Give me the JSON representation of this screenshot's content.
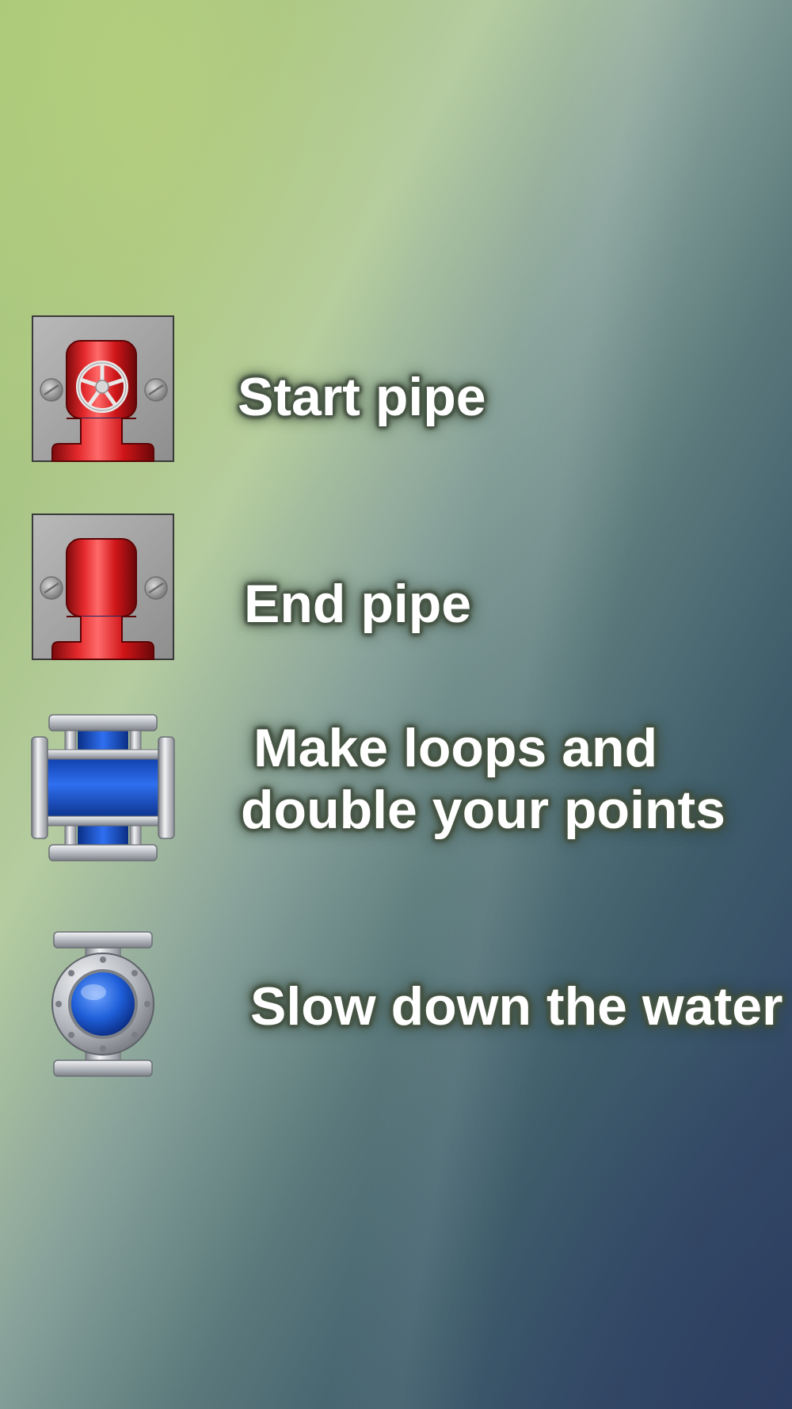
{
  "help": {
    "items": [
      {
        "icon": "start-pipe-icon",
        "label": "Start pipe"
      },
      {
        "icon": "end-pipe-icon",
        "label": "End pipe"
      },
      {
        "icon": "cross-pipe-icon",
        "label_lines": [
          "Make loops and",
          "double your points"
        ]
      },
      {
        "icon": "slow-valve-icon",
        "label": "Slow down the water"
      }
    ]
  },
  "colors": {
    "pipe_red": "#d6181c",
    "water_blue": "#1f5fd9",
    "metal": "#c9ccd0",
    "label_glow": "#4b5a48"
  }
}
